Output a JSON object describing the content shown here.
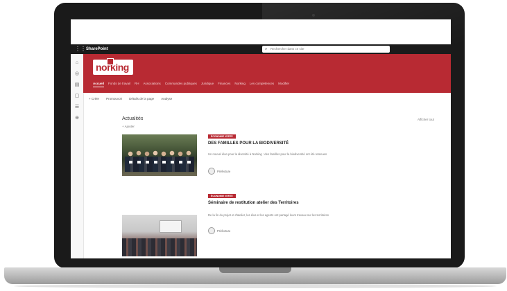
{
  "app": {
    "name": "SharePoint"
  },
  "search": {
    "placeholder": "Rechercher dans ce site"
  },
  "site": {
    "logo_text": "norking"
  },
  "nav": {
    "items": [
      {
        "label": "Accueil",
        "active": true
      },
      {
        "label": "Fonds de travail",
        "active": false
      },
      {
        "label": "RH",
        "active": false
      },
      {
        "label": "Associations",
        "active": false
      },
      {
        "label": "Commandes publiques",
        "active": false
      },
      {
        "label": "Juridique",
        "active": false
      },
      {
        "label": "Finances",
        "active": false
      },
      {
        "label": "Norking",
        "active": false
      },
      {
        "label": "Les compétences",
        "active": false
      },
      {
        "label": "Modifier",
        "active": false
      }
    ]
  },
  "command_bar": {
    "new_label": "+ Créer",
    "promote_label": "Promouvoir",
    "details_label": "Détails de la page",
    "analytics_label": "Analyse"
  },
  "news": {
    "title": "Actualités",
    "add_label": "+ Ajouter",
    "see_all": "Afficher tout",
    "items": [
      {
        "tag": "ÉCONOMIE VERTE",
        "title": "DES FAMILLES POUR LA BIODIVERSITÉ",
        "desc": "Un nouvel élan pour la diversité à Norking : des familles pour la biodiversité ont été retenues",
        "author": "Préfecture"
      },
      {
        "tag": "ÉCONOMIE VERTE",
        "title": "Séminaire de restitution atelier des Territoires",
        "desc": "De la fin du projet et d'atelier, les élus et les agents ont partagé leurs travaux sur les territoires",
        "author": "Préfecture"
      }
    ]
  },
  "colors": {
    "brand": "#b82a33",
    "suite_bar": "#1b1b1b"
  }
}
